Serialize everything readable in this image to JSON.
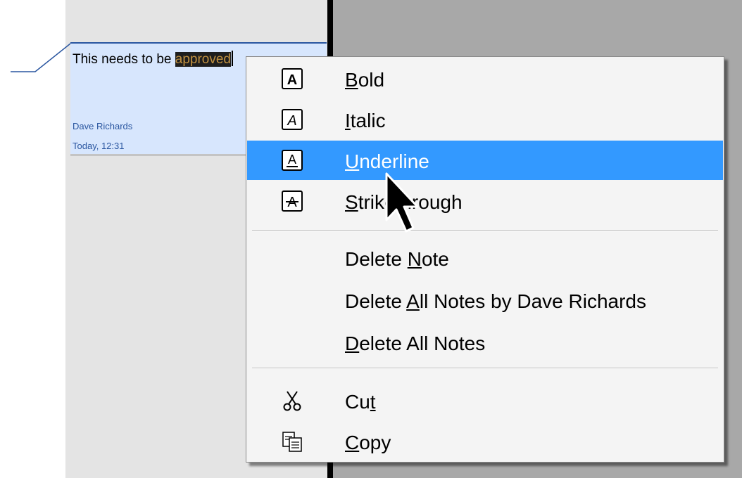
{
  "note": {
    "text_before": "This needs to be ",
    "text_selected": "approved",
    "author": "Dave Richards",
    "time": "Today, 12:31"
  },
  "context_menu": {
    "format_items": [
      {
        "id": "bold",
        "prefix": "",
        "mnemonic": "B",
        "suffix": "old",
        "icon": "bold-icon",
        "highlighted": false
      },
      {
        "id": "italic",
        "prefix": "",
        "mnemonic": "I",
        "suffix": "talic",
        "icon": "italic-icon",
        "highlighted": false
      },
      {
        "id": "underline",
        "prefix": "",
        "mnemonic": "U",
        "suffix": "nderline",
        "icon": "underline-icon",
        "highlighted": true
      },
      {
        "id": "strikethrough",
        "prefix": "",
        "mnemonic": "S",
        "suffix": "trikethrough",
        "icon": "strikethrough-icon",
        "highlighted": false
      }
    ],
    "delete_items": [
      {
        "id": "delete-note",
        "prefix": "Delete ",
        "mnemonic": "N",
        "suffix": "ote"
      },
      {
        "id": "delete-all-notes-by-author",
        "prefix": "Delete ",
        "mnemonic": "A",
        "suffix": "ll Notes by Dave Richards"
      },
      {
        "id": "delete-all-notes",
        "prefix": "",
        "mnemonic": "D",
        "suffix": "elete All Notes"
      }
    ],
    "clipboard_items": [
      {
        "id": "cut",
        "prefix": "Cu",
        "mnemonic": "t",
        "suffix": "",
        "icon": "scissors-icon"
      },
      {
        "id": "copy",
        "prefix": "",
        "mnemonic": "C",
        "suffix": "opy",
        "icon": "copy-icon"
      }
    ]
  },
  "colors": {
    "note_background": "#d7e6fd",
    "note_accent": "#2a56a0",
    "menu_highlight": "#3399ff",
    "menu_background": "#f4f4f4"
  }
}
